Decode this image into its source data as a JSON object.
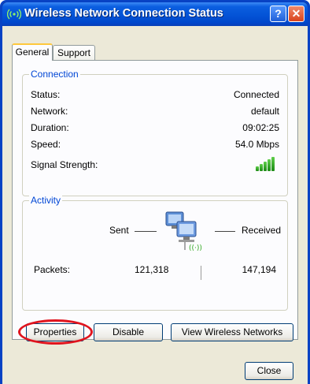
{
  "window": {
    "title": "Wireless Network Connection Status",
    "help_glyph": "?",
    "close_glyph": "✕"
  },
  "tabs": [
    {
      "label": "General",
      "selected": true
    },
    {
      "label": "Support",
      "selected": false
    }
  ],
  "connection": {
    "legend": "Connection",
    "status_label": "Status:",
    "status_value": "Connected",
    "network_label": "Network:",
    "network_value": "default",
    "duration_label": "Duration:",
    "duration_value": "09:02:25",
    "speed_label": "Speed:",
    "speed_value": "54.0 Mbps",
    "signal_label": "Signal Strength:",
    "signal_bars": 5,
    "signal_max_bars": 5
  },
  "activity": {
    "legend": "Activity",
    "sent_label": "Sent",
    "received_label": "Received",
    "packets_label": "Packets:",
    "packets_sent": "121,318",
    "packets_received": "147,194"
  },
  "buttons": {
    "properties": "Properties",
    "disable": "Disable",
    "view_networks": "View Wireless Networks",
    "close": "Close"
  },
  "colors": {
    "titlebar": "#0453d6",
    "legend_text": "#0046d5",
    "signal_green": "#2fa81f",
    "highlight_ring": "#e0141e"
  },
  "icons": [
    "wireless-icon",
    "help-icon",
    "close-icon",
    "signal-strength-icon",
    "network-computers-icon"
  ]
}
